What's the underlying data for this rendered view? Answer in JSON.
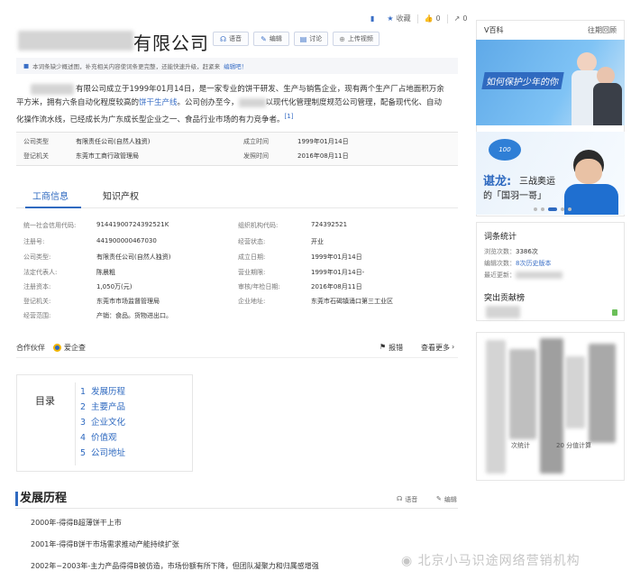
{
  "toolbar": {
    "collect_label": "收藏",
    "like_count": "0",
    "share_count": "0"
  },
  "entry": {
    "title_suffix": "有限公司",
    "buttons": [
      "语音",
      "编辑",
      "讨论",
      "上传视频"
    ]
  },
  "notice": {
    "text": "本词条缺少概述图，补充相关内容使词条更完整，还能快速升级，赶紧来",
    "link": "编辑吧！"
  },
  "summary": {
    "p1": "有限公司成立于1999年01月14日，是一家专业的饼干研发、生产与销售企业，现有两个生产厂占地面积万余",
    "p2a": "平方米，拥有六条自动化程度较高的",
    "p2link": "饼干生产线",
    "p2b": "。公司创办至今，",
    "p2c": "以现代化管理制度规范公司管理，配备现代化、自动",
    "p3": "化操作流水线，已经成长为广东成长型企业之一、食品行业市场的有力竞争者。",
    "ref": "[1]"
  },
  "basic_info": {
    "rows": [
      {
        "k1": "公司类型",
        "v1": "有限责任公司(自然人独资)",
        "k2": "成立时间",
        "v2": "1999年01月14日"
      },
      {
        "k1": "登记机关",
        "v1": "东莞市工商行政管理局",
        "k2": "发照时间",
        "v2": "2016年08月11日"
      }
    ]
  },
  "tabs": [
    "工商信息",
    "知识产权"
  ],
  "biz_info": {
    "left": [
      {
        "k": "统一社会信用代码:",
        "v": "91441900724392521K"
      },
      {
        "k": "注册号:",
        "v": "441900000467030"
      },
      {
        "k": "公司类型:",
        "v": "有限责任公司(自然人独资)"
      },
      {
        "k": "法定代表人:",
        "v": "陈晨粗"
      },
      {
        "k": "注册资本:",
        "v": "1,050万(元)"
      },
      {
        "k": "登记机关:",
        "v": "东莞市市场监督管理局"
      },
      {
        "k": "经营范围:",
        "v": "产销：食品。货物进出口。"
      }
    ],
    "right": [
      {
        "k": "组织机构代码:",
        "v": "724392521"
      },
      {
        "k": "经营状态:",
        "v": "开业"
      },
      {
        "k": "成立日期:",
        "v": "1999年01月14日"
      },
      {
        "k": "营业期限:",
        "v": "1999年01月14日-"
      },
      {
        "k": "审核/年检日期:",
        "v": "2016年08月11日"
      },
      {
        "k": "企业地址:",
        "v": "东莞市石碣镇涌口第三工业区"
      }
    ]
  },
  "partner": {
    "label": "合作伙伴",
    "brand": "爱企查",
    "report": "报错",
    "more": "查看更多"
  },
  "toc": {
    "title": "目录",
    "items": [
      {
        "n": "1",
        "label": "发展历程"
      },
      {
        "n": "2",
        "label": "主要产品"
      },
      {
        "n": "3",
        "label": "企业文化"
      },
      {
        "n": "4",
        "label": "价值观"
      },
      {
        "n": "5",
        "label": "公司地址"
      }
    ]
  },
  "section": {
    "title": "发展历程",
    "voice": "语音",
    "edit": "编辑",
    "items": [
      "2000年-得得B超薄饼干上市",
      "2001年-得得B饼干市场需求推动产能持续扩张",
      "2002年~2003年-主力产品得得B被仿造，市场份额有所下降，但团队凝聚力和归属感增强"
    ]
  },
  "sidebar": {
    "vbaike": "V百科",
    "past": "往期回顾",
    "banner1_text": "如何保护少年的你",
    "banner2_name": "谌龙:",
    "banner2_line1": "三战奥运",
    "banner2_line2": "的「国羽一哥」",
    "stats_title": "词条统计",
    "stats": [
      {
        "k": "浏览次数：",
        "v": "3386次"
      },
      {
        "k": "编辑次数：",
        "v": "8次历史版本"
      },
      {
        "k": "最近更新：",
        "v": ""
      }
    ],
    "contrib": "突出贡献榜",
    "blur_a": "次统计",
    "blur_b": "20 分值计算"
  },
  "watermark": "北京小马识途网络营销机构"
}
